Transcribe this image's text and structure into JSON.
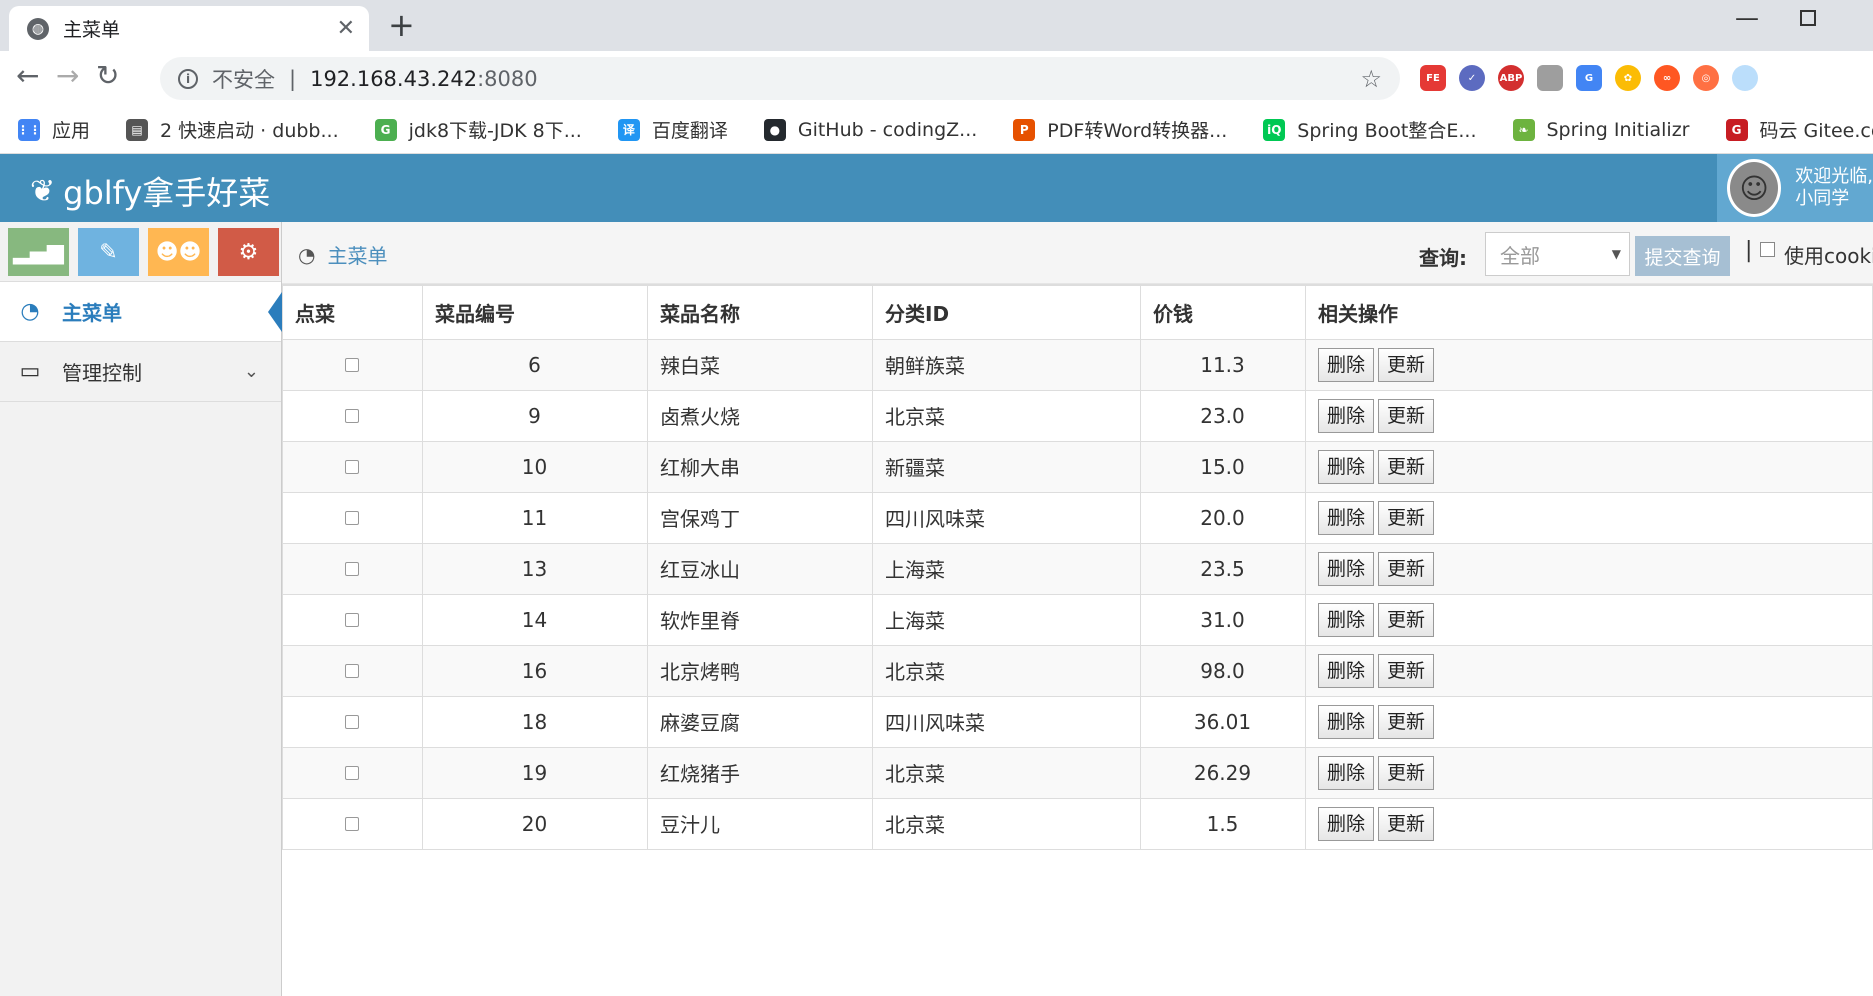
{
  "browser": {
    "tab_title": "主菜单",
    "omnibox_insecure": "不安全",
    "omnibox_host": "192.168.43.242",
    "omnibox_port": ":8080",
    "bookmarks": [
      {
        "label": "应用",
        "icon": "apps-grid-icon",
        "color": "#4285f4"
      },
      {
        "label": "2 快速启动 · dubb...",
        "icon": "book-icon",
        "color": "#555555"
      },
      {
        "label": "jdk8下载-JDK 8下...",
        "icon": "g-plus-icon",
        "color": "#4caf50"
      },
      {
        "label": "百度翻译",
        "icon": "translate-icon",
        "color": "#2196f3"
      },
      {
        "label": "GitHub - codingZ...",
        "icon": "github-icon",
        "color": "#24292e"
      },
      {
        "label": "PDF转Word转换器...",
        "icon": "pdf-icon",
        "color": "#e65100"
      },
      {
        "label": "Spring Boot整合E...",
        "icon": "iqiyi-icon",
        "color": "#00c853"
      },
      {
        "label": "Spring Initializr",
        "icon": "spring-icon",
        "color": "#6db33f"
      },
      {
        "label": "码云 Gitee.com",
        "icon": "gitee-icon",
        "color": "#c71d23"
      }
    ]
  },
  "app": {
    "brand": "gblfy拿手好菜",
    "welcome_line1": "欢迎光临,",
    "welcome_line2": "小同学"
  },
  "sidebar": {
    "shortcuts": [
      {
        "icon": "signal-icon",
        "color": "#87b87f"
      },
      {
        "icon": "pencil-icon",
        "color": "#6fb3e0"
      },
      {
        "icon": "users-icon",
        "color": "#ffb752"
      },
      {
        "icon": "cogs-icon",
        "color": "#d15b47"
      }
    ],
    "items": [
      {
        "label": "主菜单",
        "icon": "dashboard-icon",
        "active": true
      },
      {
        "label": "管理控制",
        "icon": "desktop-icon",
        "active": false
      }
    ]
  },
  "main": {
    "breadcrumb": "主菜单",
    "query_label": "查询:",
    "category_selected": "全部",
    "submit_label": "提交查询",
    "cookie_sep": "|",
    "cookie_label": "使用cookie",
    "columns": [
      "点菜",
      "菜品编号",
      "菜品名称",
      "分类ID",
      "价钱",
      "相关操作"
    ],
    "delete_label": "删除",
    "update_label": "更新",
    "rows": [
      {
        "id": "6",
        "name": "辣白菜",
        "category": "朝鲜族菜",
        "price": "11.3"
      },
      {
        "id": "9",
        "name": "卤煮火烧",
        "category": "北京菜",
        "price": "23.0"
      },
      {
        "id": "10",
        "name": "红柳大串",
        "category": "新疆菜",
        "price": "15.0"
      },
      {
        "id": "11",
        "name": "宫保鸡丁",
        "category": "四川风味菜",
        "price": "20.0"
      },
      {
        "id": "13",
        "name": "红豆冰山",
        "category": "上海菜",
        "price": "23.5"
      },
      {
        "id": "14",
        "name": "软炸里脊",
        "category": "上海菜",
        "price": "31.0"
      },
      {
        "id": "16",
        "name": "北京烤鸭",
        "category": "北京菜",
        "price": "98.0"
      },
      {
        "id": "18",
        "name": "麻婆豆腐",
        "category": "四川风味菜",
        "price": "36.01"
      },
      {
        "id": "19",
        "name": "红烧猪手",
        "category": "北京菜",
        "price": "26.29"
      },
      {
        "id": "20",
        "name": "豆汁儿",
        "category": "北京菜",
        "price": "1.5"
      }
    ]
  },
  "colors": {
    "header": "#438eb9",
    "active_nav": "#2b7dbc"
  }
}
